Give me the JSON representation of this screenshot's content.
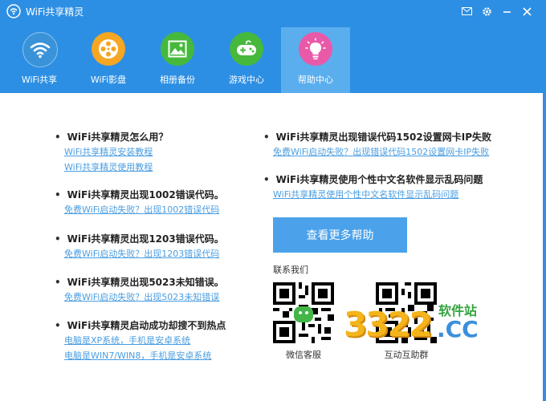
{
  "window": {
    "title": "WiFi共享精灵",
    "controls": [
      "mail-icon",
      "gear-icon",
      "minimize-icon",
      "close-icon"
    ]
  },
  "nav": {
    "items": [
      {
        "label": "WiFi共享",
        "icon": "wifi-icon",
        "color": "#3a93d8"
      },
      {
        "label": "WiFi影盘",
        "icon": "film-reel-icon",
        "color": "#f5a623"
      },
      {
        "label": "相册备份",
        "icon": "photo-icon",
        "color": "#46b93c"
      },
      {
        "label": "游戏中心",
        "icon": "gamepad-icon",
        "color": "#46b93c"
      },
      {
        "label": "帮助中心",
        "icon": "lightbulb-icon",
        "color": "#e85aa8",
        "active": true
      }
    ]
  },
  "help": {
    "left": [
      {
        "title": "WiFi共享精灵怎么用？",
        "links": [
          "WiFi共享精灵安装教程",
          "WiFi共享精灵使用教程"
        ]
      },
      {
        "title": "WiFi共享精灵出现1002错误代码。",
        "links": [
          "免费WiFi启动失败？出现1002错误代码"
        ]
      },
      {
        "title": "WiFi共享精灵出现1203错误代码。",
        "links": [
          "免费WiFi启动失败？出现1203错误代码"
        ]
      },
      {
        "title": "WiFi共享精灵出现5023未知错误。",
        "links": [
          "免费WiFi启动失败？出现5023未知错误"
        ]
      },
      {
        "title": "WiFi共享精灵启动成功却搜不到热点",
        "links": [
          "电脑是XP系统，手机是安卓系统",
          "电脑是WIN7/WIN8，手机是安卓系统"
        ]
      }
    ],
    "right": [
      {
        "title": "WiFi共享精灵出现错误代码1502设置网卡IP失败",
        "links": [
          "免费WiFi启动失败？出现错误代码1502设置网卡IP失败"
        ]
      },
      {
        "title": "WiFi共享精灵使用个性中文名软件显示乱码问题",
        "links": [
          "WiFi共享精灵使用个性中文名软件显示乱码问题"
        ]
      }
    ],
    "more_button": "查看更多帮助",
    "contact_title": "联系我们",
    "qr_codes": [
      {
        "label": "微信客服",
        "icon": "wechat-qr-code"
      },
      {
        "label": "互动互助群",
        "icon": "group-qr-code"
      }
    ]
  },
  "watermark": {
    "number": "3322",
    "cn_text": "软件站",
    "domain": ".CC"
  }
}
